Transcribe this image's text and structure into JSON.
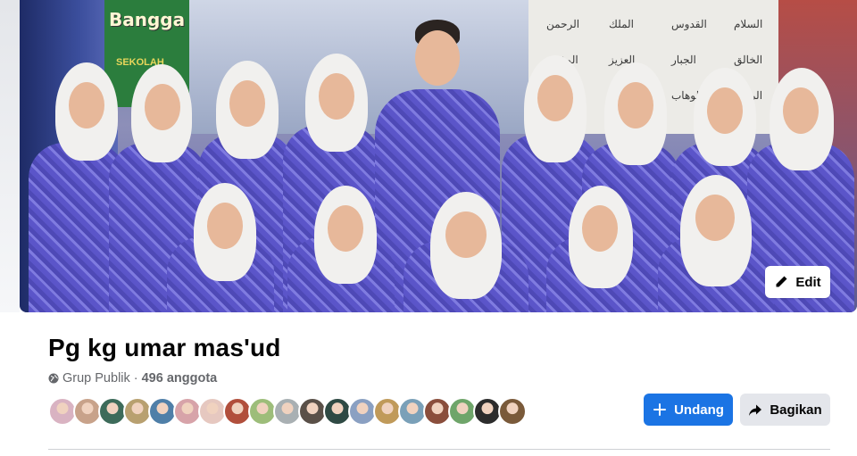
{
  "cover": {
    "banner_text": "Bangga",
    "banner_subtext": "SEKOLAH",
    "edit_label": "Edit"
  },
  "group": {
    "name": "Pg kg umar mas'ud",
    "privacy": "Grup Publik",
    "separator": "·",
    "member_count": "496 anggota"
  },
  "members_preview": [
    {
      "color": "#d9b3c2"
    },
    {
      "color": "#c8a28a"
    },
    {
      "color": "#3d6b5a"
    },
    {
      "color": "#b8a070"
    },
    {
      "color": "#4f7fa8"
    },
    {
      "color": "#d7a3a9"
    },
    {
      "color": "#e6c8c0"
    },
    {
      "color": "#b14f3c"
    },
    {
      "color": "#9dbd7a"
    },
    {
      "color": "#a9b0b3"
    },
    {
      "color": "#5a5048"
    },
    {
      "color": "#2f4a44"
    },
    {
      "color": "#8aa0c2"
    },
    {
      "color": "#c09a5a"
    },
    {
      "color": "#7aa0b8"
    },
    {
      "color": "#8a4e3c"
    },
    {
      "color": "#6fa56a"
    },
    {
      "color": "#2c2c2c"
    },
    {
      "color": "#7a5a3a"
    }
  ],
  "actions": {
    "invite_label": "Undang",
    "share_label": "Bagikan"
  },
  "colors": {
    "primary": "#1b74e4",
    "secondary_bg": "#e4e6eb",
    "muted_text": "#65676b"
  }
}
